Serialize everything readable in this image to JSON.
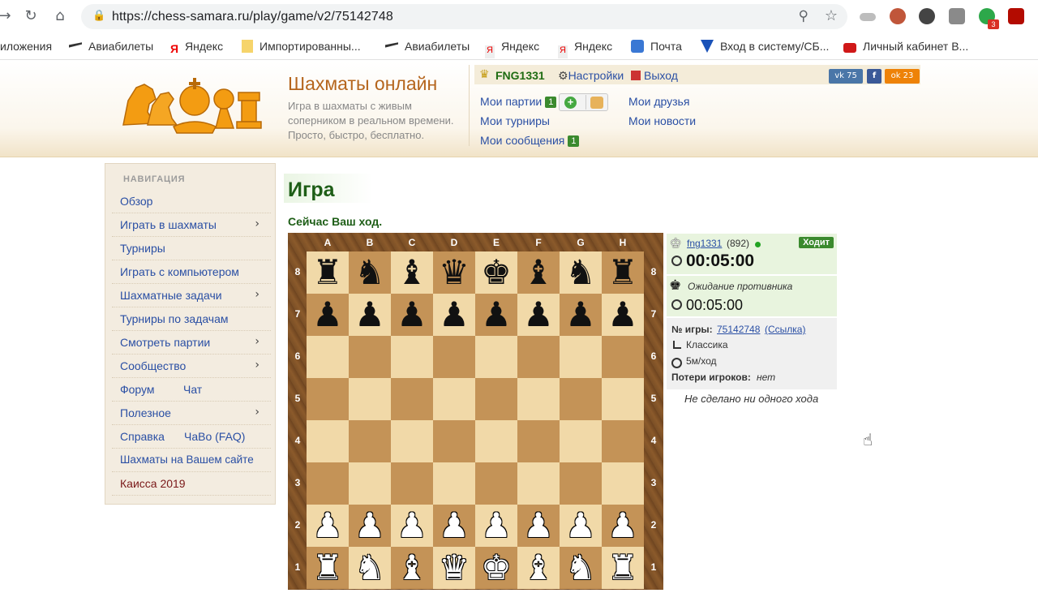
{
  "browser": {
    "url": "https://chess-samara.ru/play/game/v2/75142748",
    "extension_badge": "3"
  },
  "bookmarks": [
    {
      "label": "иложения",
      "icon": "apps-icon"
    },
    {
      "label": "Авиабилеты",
      "icon": "plane-icon"
    },
    {
      "label": "Яндекс",
      "icon": "yandex-icon"
    },
    {
      "label": "Импортированны...",
      "icon": "folder-icon"
    },
    {
      "label": "Авиабилеты",
      "icon": "plane-icon"
    },
    {
      "label": "Яндекс",
      "icon": "yandex-icon"
    },
    {
      "label": "Яндекс",
      "icon": "yandex-icon"
    },
    {
      "label": "Почта",
      "icon": "mail-icon"
    },
    {
      "label": "Вход в систему/СБ...",
      "icon": "bank-icon"
    },
    {
      "label": "Личный кабинет В...",
      "icon": "cabinet-icon"
    }
  ],
  "site": {
    "title": "Шахматы онлайн",
    "subtitle": "Игра в шахматы с живым соперником в реальном времени. Просто, быстро, бесплатно.",
    "user": "FNG1331",
    "settings": "Настройки",
    "logout": "Выход",
    "vk_count": "75",
    "ok_count": "23",
    "links": {
      "my_games": "Мои партии",
      "my_games_badge": "1",
      "my_tournaments": "Мои турниры",
      "my_messages": "Мои сообщения",
      "my_messages_badge": "1",
      "my_friends": "Мои друзья",
      "my_news": "Мои новости"
    }
  },
  "sidebar": {
    "heading": "НАВИГАЦИЯ",
    "items": [
      {
        "label": "Обзор",
        "arrow": false
      },
      {
        "label": "Играть в шахматы",
        "arrow": true
      },
      {
        "label": "Турниры",
        "arrow": false
      },
      {
        "label": "Играть с компьютером",
        "arrow": false
      },
      {
        "label": "Шахматные задачи",
        "arrow": true
      },
      {
        "label": "Турниры по задачам",
        "arrow": false
      },
      {
        "label": "Смотреть партии",
        "arrow": true
      },
      {
        "label": "Сообщество",
        "arrow": true
      },
      {
        "label": "Форум",
        "label2": "Чат",
        "arrow": false
      },
      {
        "label": "Полезное",
        "arrow": true
      },
      {
        "label": "Справка",
        "label2": "ЧаВо (FAQ)",
        "arrow": false
      },
      {
        "label": "Шахматы на Вашем сайте",
        "arrow": false
      },
      {
        "label": "Каисса 2019",
        "arrow": false
      }
    ]
  },
  "game": {
    "title": "Игра",
    "turn_message": "Сейчас Ваш ход.",
    "files": [
      "A",
      "B",
      "C",
      "D",
      "E",
      "F",
      "G",
      "H"
    ],
    "ranks": [
      "8",
      "7",
      "6",
      "5",
      "4",
      "3",
      "2",
      "1"
    ],
    "position": [
      [
        "♜",
        "♞",
        "♝",
        "♛",
        "♚",
        "♝",
        "♞",
        "♜"
      ],
      [
        "♟",
        "♟",
        "♟",
        "♟",
        "♟",
        "♟",
        "♟",
        "♟"
      ],
      [
        "",
        "",
        "",
        "",
        "",
        "",
        "",
        ""
      ],
      [
        "",
        "",
        "",
        "",
        "",
        "",
        "",
        ""
      ],
      [
        "",
        "",
        "",
        "",
        "",
        "",
        "",
        ""
      ],
      [
        "",
        "",
        "",
        "",
        "",
        "",
        "",
        ""
      ],
      [
        "♙",
        "♙",
        "♙",
        "♙",
        "♙",
        "♙",
        "♙",
        "♙"
      ],
      [
        "♖",
        "♘",
        "♗",
        "♕",
        "♔",
        "♗",
        "♘",
        "♖"
      ]
    ],
    "player1": {
      "name": "fng1331",
      "rating": "(892)",
      "status": "Ходит",
      "clock": "00:05:00"
    },
    "player2": {
      "name": "Ожидание противника",
      "clock": "00:05:00"
    },
    "game_no_label": "№ игры:",
    "game_no": "75142748",
    "game_link": "(Ссылка)",
    "type": "Классика",
    "time_control": "5м/ход",
    "losses_label": "Потери игроков:",
    "losses_value": "нет",
    "no_moves": "Не сделано ни одного хода"
  },
  "colors": {
    "accent_green": "#1e5e17",
    "link_blue": "#2a4fa4",
    "logo_orange": "#f39c12",
    "board_light": "#f1d9a8",
    "board_dark": "#c49357"
  }
}
